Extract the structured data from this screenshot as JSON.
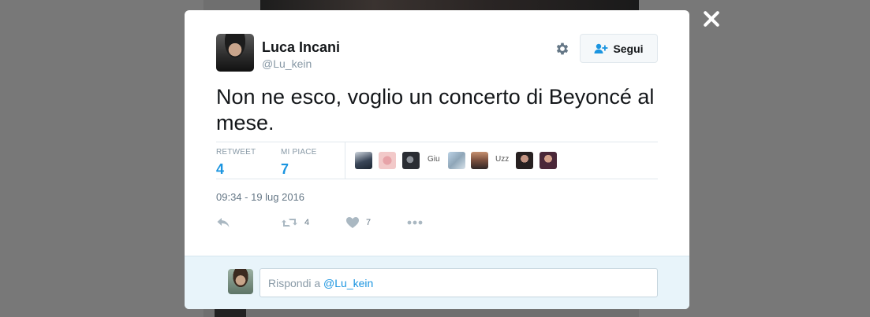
{
  "tweet": {
    "author": {
      "name": "Luca Incani",
      "handle": "@Lu_kein"
    },
    "follow_label": "Segui",
    "text": "Non ne esco, voglio un concerto di Beyoncé al mese.",
    "stats": [
      {
        "label": "RETWEET",
        "value": "4"
      },
      {
        "label": "MI PIACE",
        "value": "7"
      }
    ],
    "likers": [
      "",
      "",
      "",
      "Giu",
      "",
      "",
      "Uzz",
      "",
      ""
    ],
    "timestamp": "09:34 - 19 lug 2016",
    "actions": {
      "retweet_count": "4",
      "like_count": "7"
    }
  },
  "reply": {
    "placeholder_prefix": "Rispondi a ",
    "placeholder_mention": "@Lu_kein"
  },
  "colors": {
    "link": "#1b95e0",
    "muted": "#8899a6",
    "reply_bg": "#e8f4fa"
  },
  "icons": [
    "close-icon",
    "gear-icon",
    "follow-user-icon",
    "reply-icon",
    "retweet-icon",
    "heart-icon",
    "more-icon"
  ]
}
